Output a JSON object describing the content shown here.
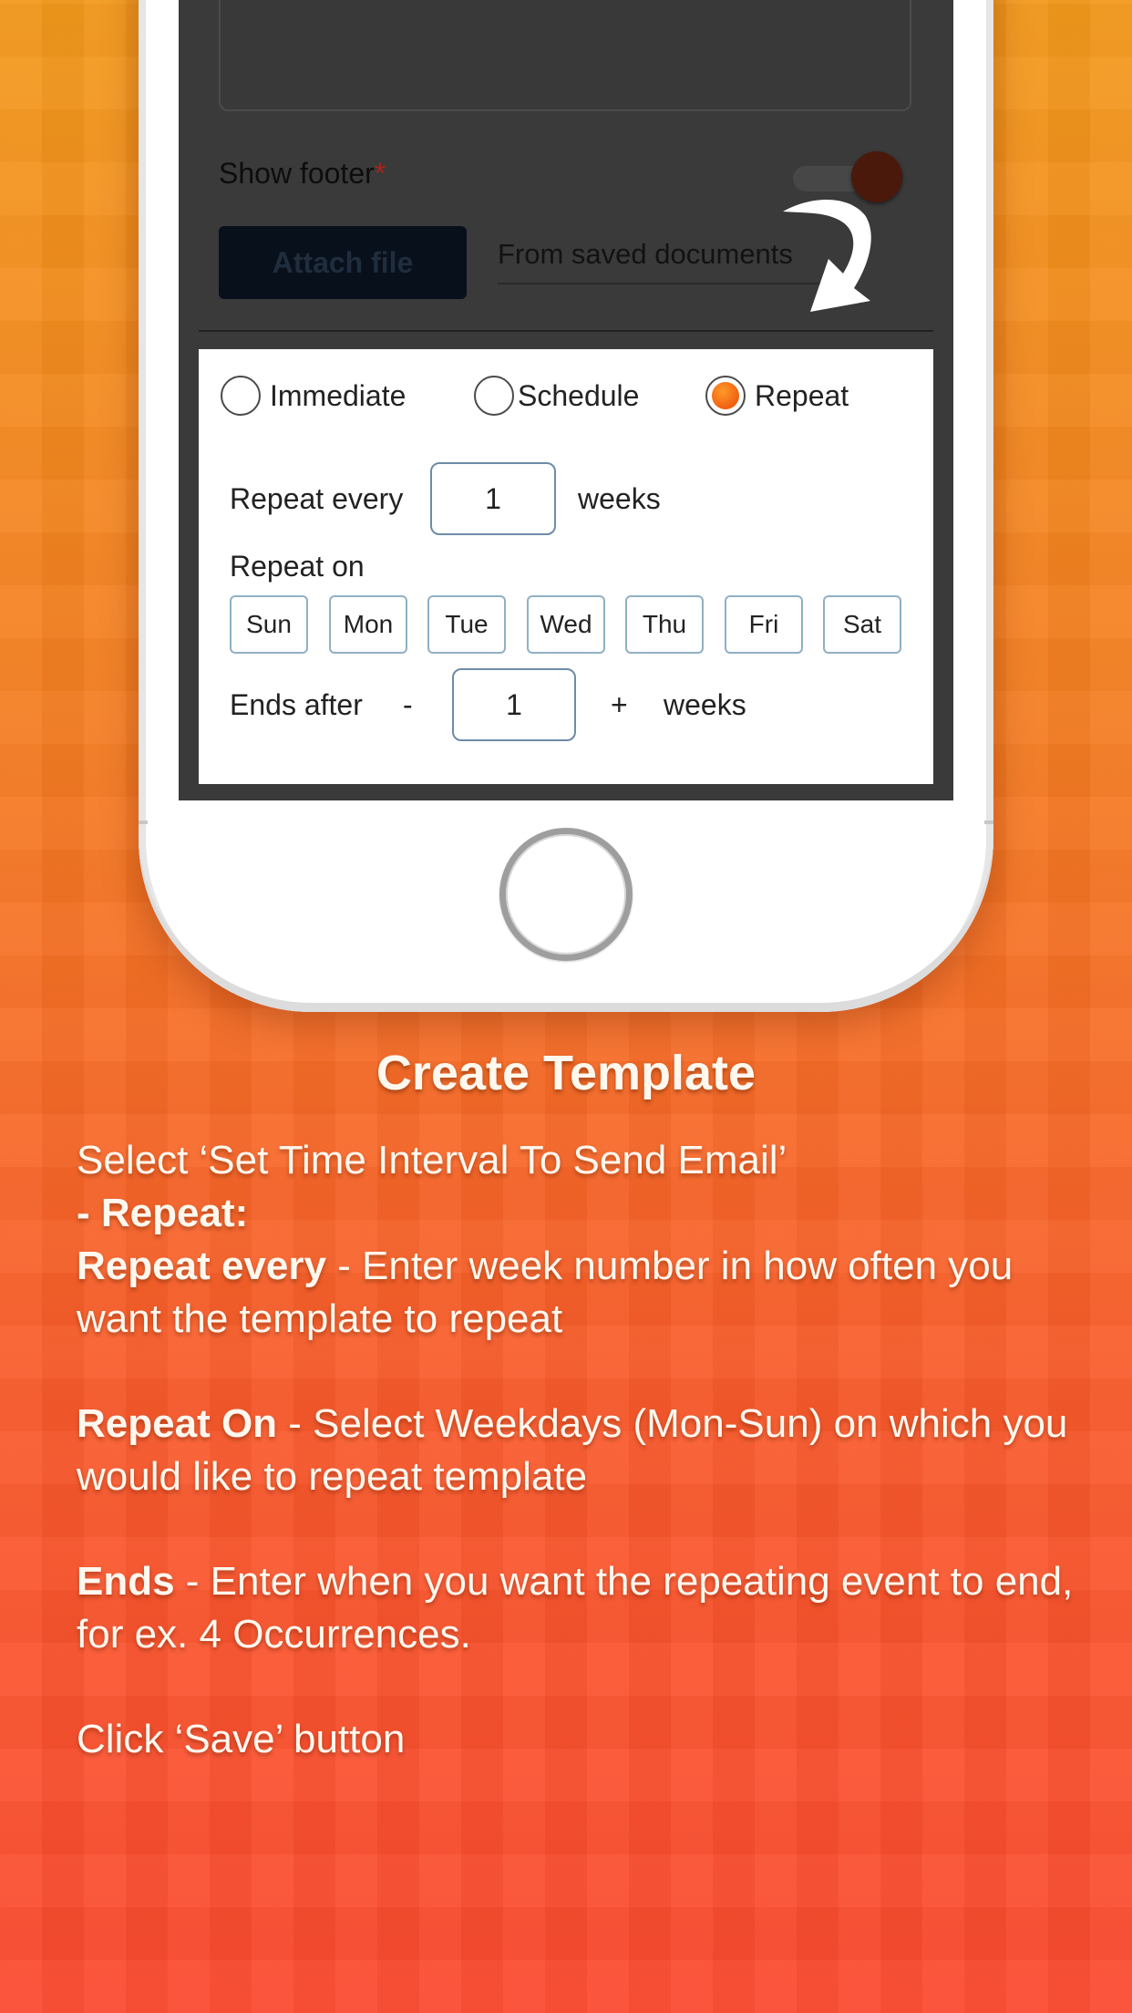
{
  "screen": {
    "show_footer_label": "Show footer",
    "required_mark": "*",
    "attach_file_label": "Attach file",
    "from_saved_documents": "From saved documents"
  },
  "send_options": {
    "immediate": "Immediate",
    "schedule": "Schedule",
    "repeat": "Repeat",
    "selected": "Repeat"
  },
  "repeat": {
    "repeat_every_label": "Repeat every",
    "repeat_every_value": "1",
    "repeat_every_unit": "weeks",
    "repeat_on_label": "Repeat on",
    "days": [
      "Sun",
      "Mon",
      "Tue",
      "Wed",
      "Thu",
      "Fri",
      "Sat"
    ],
    "ends_after_label": "Ends after",
    "minus": "-",
    "ends_after_value": "1",
    "plus": "+",
    "ends_after_unit": "weeks"
  },
  "caption": {
    "title": "Create Template",
    "line1": "Select ‘Set Time Interval To Send Email’",
    "line2": "- Repeat:",
    "repeat_every_bold": "Repeat every",
    "repeat_every_text": " - Enter week number in how often you want the template to repeat",
    "repeat_on_bold": "Repeat On",
    "repeat_on_text": " - Select Weekdays (Mon-Sun) on which you would like to repeat template",
    "ends_bold": "Ends",
    "ends_text": " - Enter when you want the repeating event to end, for ex. 4 Occurrences.",
    "click_save": "Click ‘Save’ button"
  },
  "colors": {
    "background_top": "#f39a1c",
    "background_bottom": "#fb4a30",
    "radio_selected": "#f06010",
    "screen_dark": "#3a3a3a"
  },
  "icons": {
    "arrow": "curved-arrow-icon",
    "home": "home-button-icon"
  }
}
